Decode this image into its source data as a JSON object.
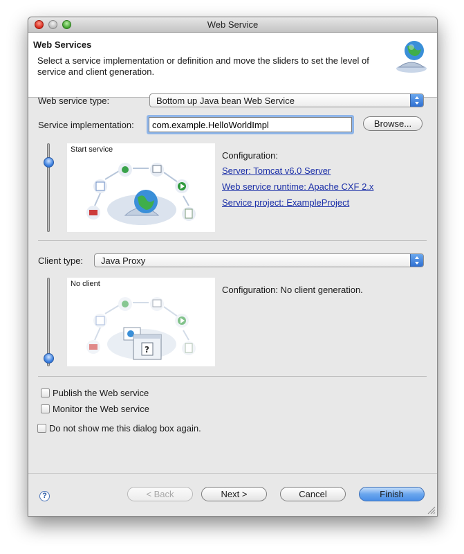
{
  "window": {
    "title": "Web Service"
  },
  "banner": {
    "title": "Web Services",
    "description": "Select a service implementation or definition and move the sliders to set the level of service and client generation."
  },
  "service": {
    "type_label": "Web service type:",
    "type_value": "Bottom up Java bean Web Service",
    "impl_label": "Service implementation:",
    "impl_value": "com.example.HelloWorldImpl",
    "browse_label": "Browse...",
    "slider_level": "Start service",
    "preview_label": "Start service",
    "config_title": "Configuration:",
    "server_link": "Server: Tomcat v6.0 Server",
    "runtime_link": "Web service runtime: Apache CXF 2.x",
    "project_link": "Service project: ExampleProject"
  },
  "client": {
    "type_label": "Client type:",
    "type_value": "Java Proxy",
    "slider_level": "No client",
    "preview_label": "No client",
    "config_text": "Configuration: No client generation."
  },
  "options": {
    "publish_label": "Publish the Web service",
    "publish_checked": false,
    "monitor_label": "Monitor the Web service",
    "monitor_checked": false,
    "dont_show_label": "Do not show me this dialog box again.",
    "dont_show_checked": false
  },
  "footer": {
    "back_label": "< Back",
    "next_label": "Next >",
    "cancel_label": "Cancel",
    "finish_label": "Finish",
    "help_glyph": "?"
  },
  "icons": {
    "banner": "globe-server-icon",
    "help": "help-icon",
    "dropdown": "stepper-arrows-icon",
    "resize": "resize-grip-icon"
  },
  "colors": {
    "accent": "#3f82e0",
    "link": "#1b2fa8",
    "focus_ring": "#8fb5e8"
  }
}
